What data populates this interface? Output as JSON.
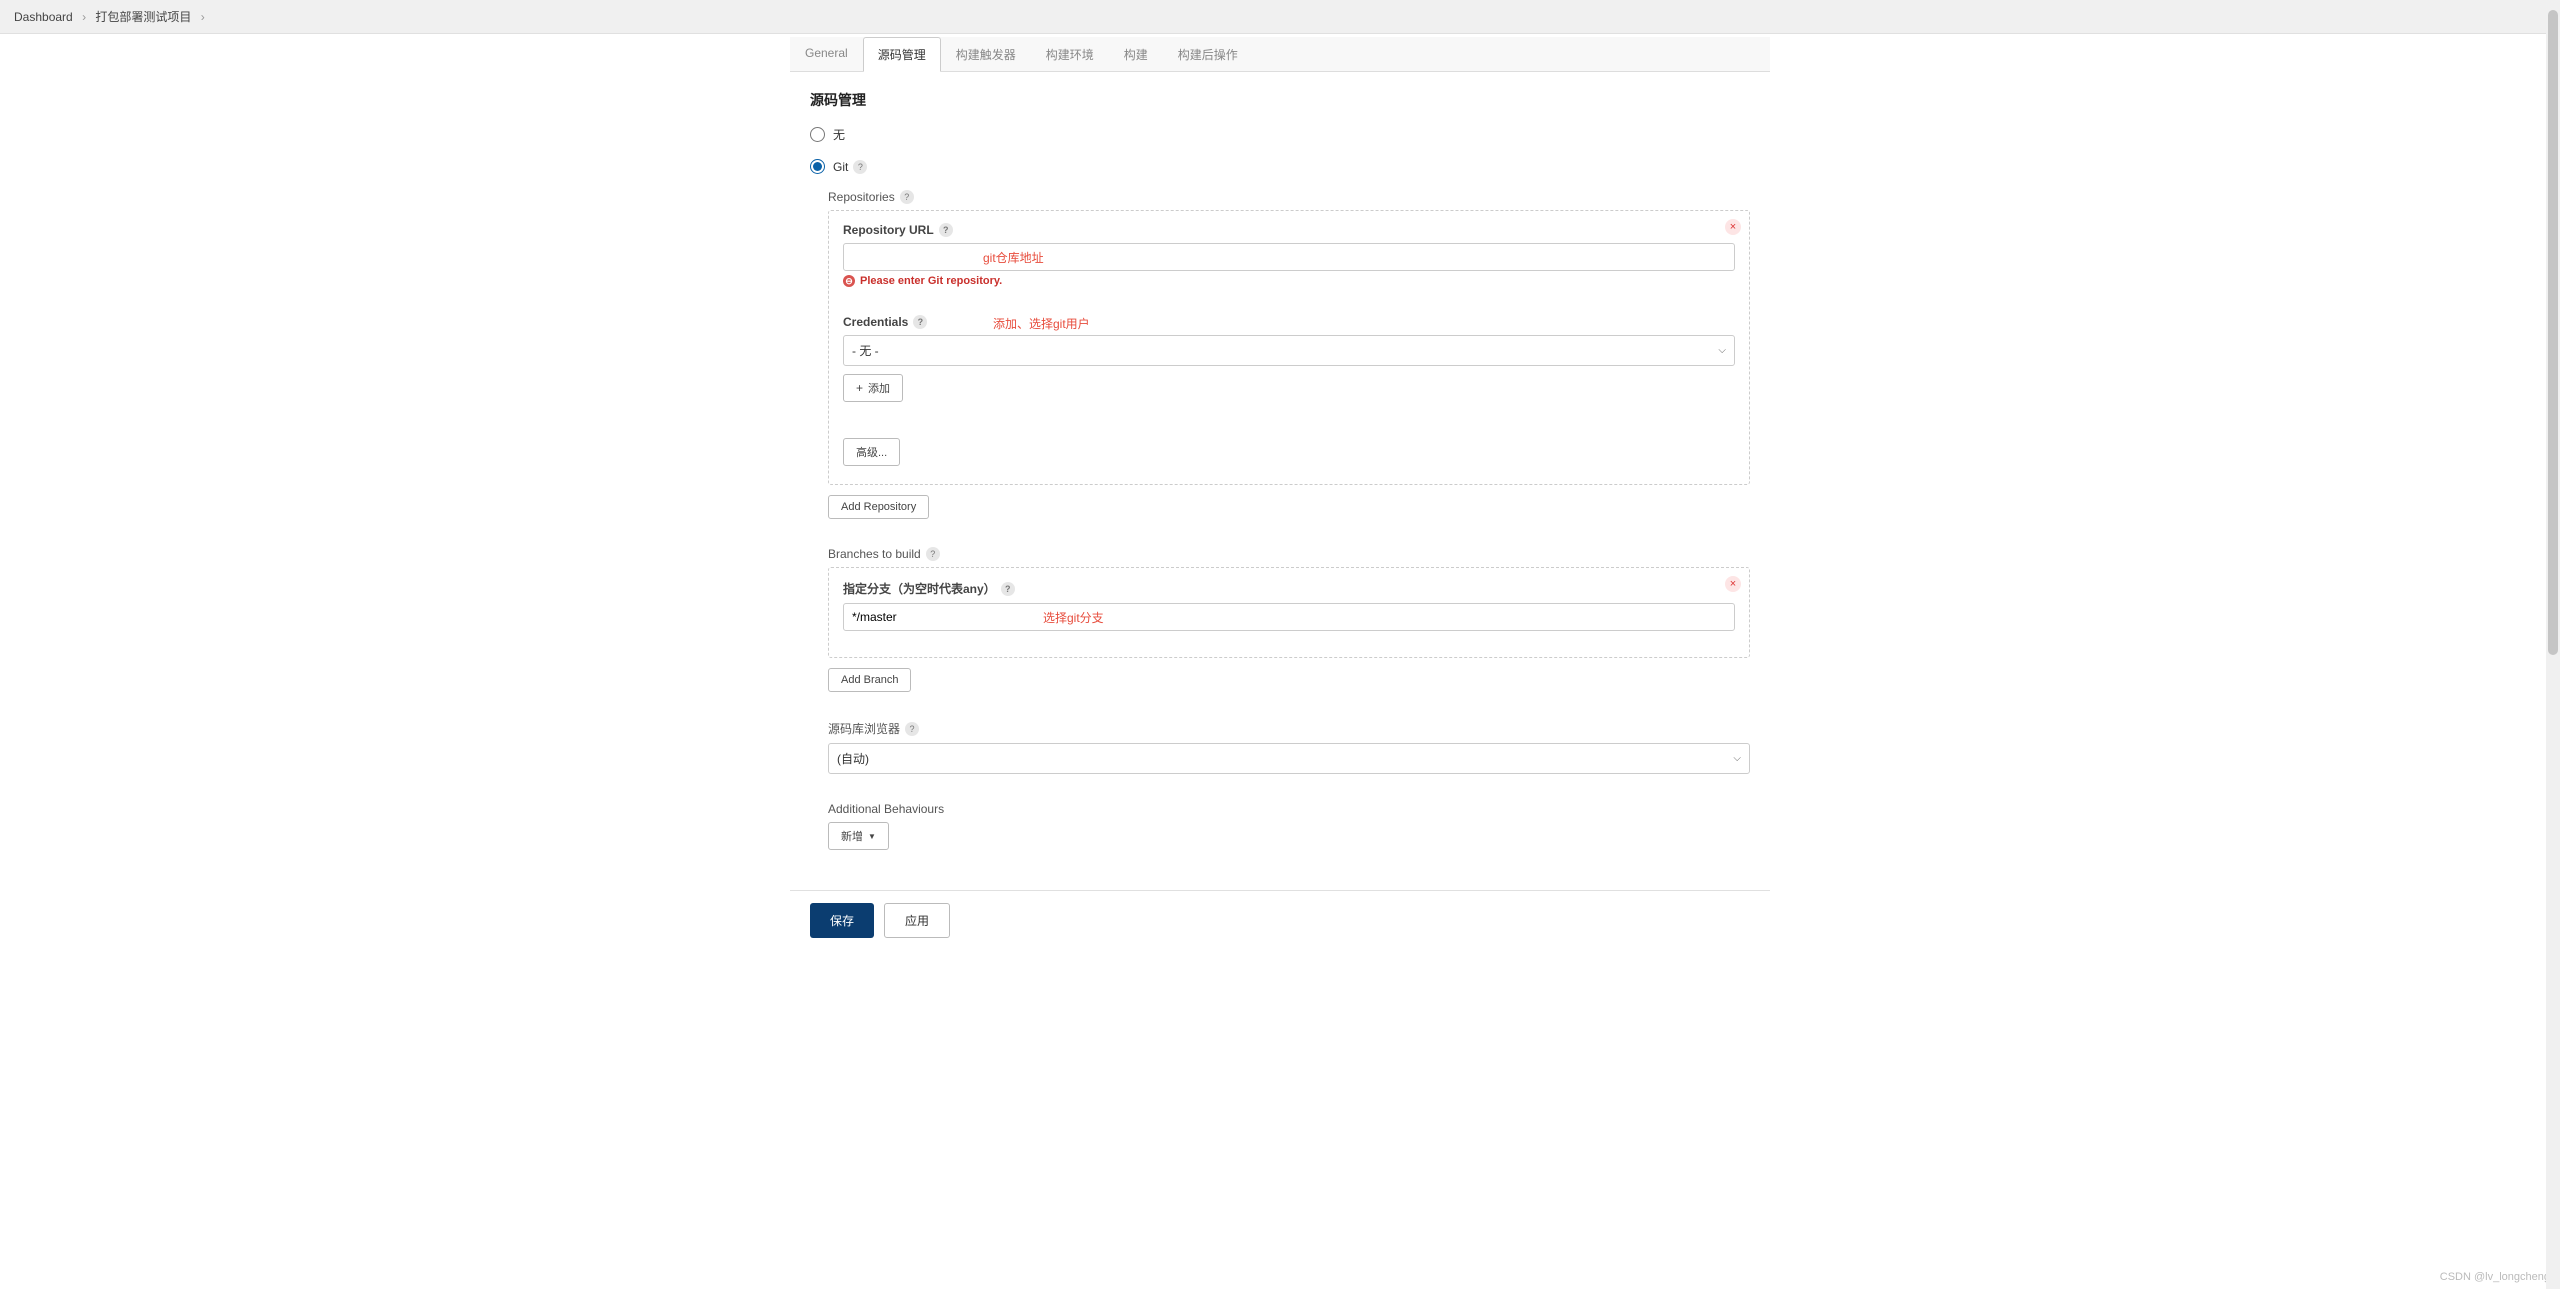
{
  "breadcrumb": {
    "items": [
      "Dashboard",
      "打包部署测试项目"
    ]
  },
  "tabs": [
    {
      "label": "General",
      "active": false
    },
    {
      "label": "源码管理",
      "active": true
    },
    {
      "label": "构建触发器",
      "active": false
    },
    {
      "label": "构建环境",
      "active": false
    },
    {
      "label": "构建",
      "active": false
    },
    {
      "label": "构建后操作",
      "active": false
    }
  ],
  "section": {
    "title": "源码管理"
  },
  "scm": {
    "none_label": "无",
    "git_label": "Git",
    "repositories_label": "Repositories",
    "repo_url_label": "Repository URL",
    "repo_url_value": "",
    "repo_url_error": "Please enter Git repository.",
    "annotation_repo": "git仓库地址",
    "credentials_label": "Credentials",
    "credentials_value": "- 无 -",
    "annotation_cred": "添加、选择git用户",
    "add_btn": "添加",
    "advanced_btn": "高级...",
    "add_repository_btn": "Add Repository",
    "branches_label": "Branches to build",
    "branch_spec_label": "指定分支（为空时代表any）",
    "branch_value": "*/master",
    "annotation_branch": "选择git分支",
    "add_branch_btn": "Add Branch",
    "repo_browser_label": "源码库浏览器",
    "repo_browser_value": "(自动)",
    "behaviours_label": "Additional Behaviours",
    "behaviours_add_btn": "新增"
  },
  "footer": {
    "save": "保存",
    "apply": "应用"
  },
  "watermark": "CSDN @lv_longcheng"
}
